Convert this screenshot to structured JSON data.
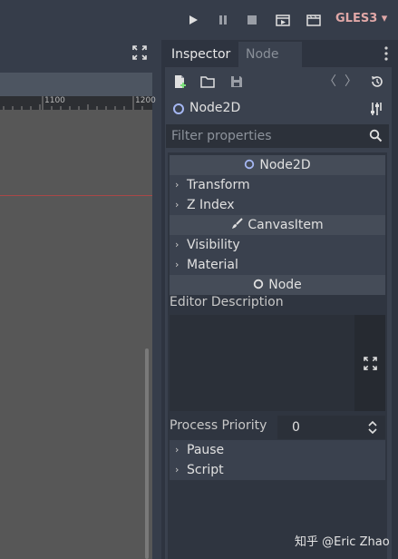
{
  "toolbar": {
    "play_icon": "play-icon",
    "pause_icon": "pause-icon",
    "stop_icon": "stop-icon",
    "play_scene_icon": "play-scene-icon",
    "play_custom_icon": "play-custom-scene-icon",
    "renderer": "GLES3 ▾"
  },
  "viewport": {
    "ruler_ticks": [
      "1100",
      "1200"
    ]
  },
  "dock": {
    "tabs": [
      "Inspector",
      "Node"
    ],
    "menu_icon": "vertical-dots-icon"
  },
  "inspector": {
    "node_name": "Node2D",
    "filter_placeholder": "Filter properties",
    "sections": {
      "node2d": "Node2D",
      "canvas_item": "CanvasItem",
      "node": "Node"
    },
    "groups": {
      "transform": "Transform",
      "z_index": "Z Index",
      "visibility": "Visibility",
      "material": "Material",
      "pause": "Pause",
      "script": "Script"
    },
    "editor_description": "Editor Description",
    "process_priority": {
      "label": "Process Priority",
      "value": "0"
    }
  },
  "watermark": "知乎 @Eric Zhao",
  "colors": {
    "accent_node": "#a5b7f3",
    "renderer_text": "#e0a7a7",
    "origin_line": "#a94848"
  }
}
